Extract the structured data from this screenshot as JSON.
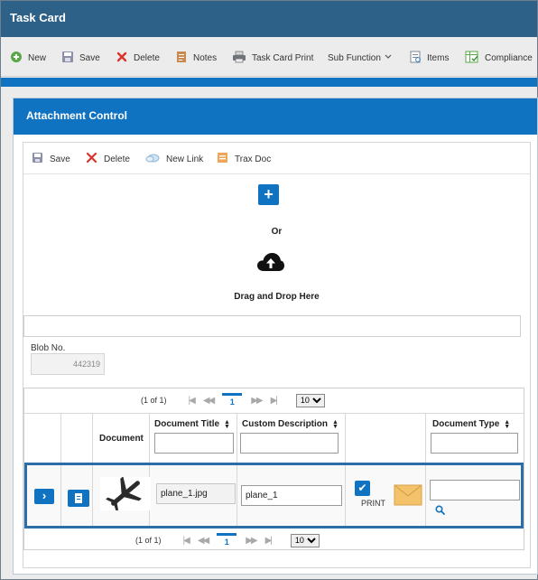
{
  "window": {
    "title": "Task Card"
  },
  "toolbar": {
    "new_label": "New",
    "save_label": "Save",
    "delete_label": "Delete",
    "notes_label": "Notes",
    "print_label": "Task Card Print",
    "subfunction_label": "Sub Function",
    "items_label": "Items",
    "compliance_label": "Compliance"
  },
  "panel": {
    "title": "Attachment Control"
  },
  "attachment_toolbar": {
    "save_label": "Save",
    "delete_label": "Delete",
    "new_link_label": "New Link",
    "trax_doc_label": "Trax Doc"
  },
  "upload": {
    "plus_symbol": "+",
    "or_text": "Or",
    "drag_text": "Drag and Drop Here"
  },
  "blob": {
    "label": "Blob No.",
    "value": "442319"
  },
  "pager": {
    "count_text": "(1 of 1)",
    "page": "1",
    "page_size": "10",
    "page_size_options": [
      "10"
    ]
  },
  "grid": {
    "columns": {
      "document": "Document",
      "document_title": "Document Title",
      "custom_description": "Custom Description",
      "document_type": "Document Type"
    },
    "rows": [
      {
        "title": "plane_1.jpg",
        "description": "plane_1",
        "print_label": "PRINT",
        "document_type": ""
      }
    ]
  },
  "colors": {
    "titlebar": "#2e6188",
    "accent": "#0f73c2",
    "selected_row_border": "#2d6ea8",
    "envelope": "#f4c26b"
  },
  "icons": [
    "new-icon",
    "save-icon",
    "delete-icon",
    "notes-icon",
    "print-icon",
    "chevron-down-icon",
    "items-icon",
    "compliance-icon",
    "new-link-icon",
    "trax-doc-icon",
    "plus-icon",
    "cloud-upload-icon",
    "first-page-icon",
    "prev-page-icon",
    "next-page-icon",
    "last-page-icon",
    "sort-icon",
    "expand-icon",
    "document-icon",
    "airplane-icon",
    "checkmark-icon",
    "envelope-icon",
    "search-icon"
  ]
}
